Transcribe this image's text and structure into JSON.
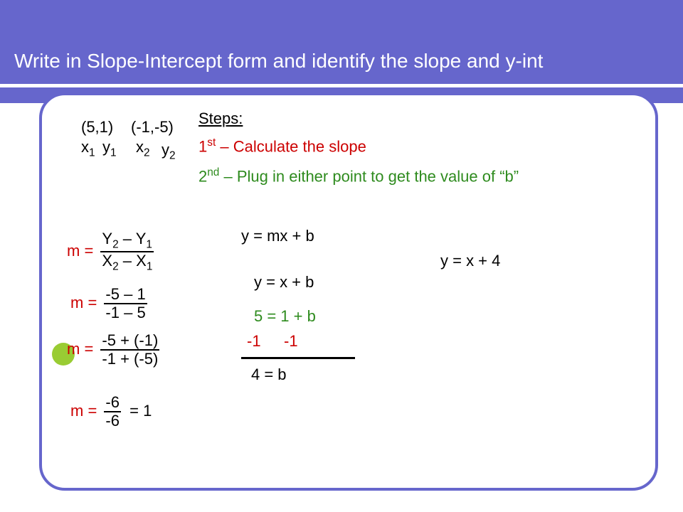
{
  "title": "Write in Slope-Intercept form and identify the slope and y-int",
  "points": {
    "p1": "(5,1)",
    "p2": "(-1,-5)",
    "label_x1": "x",
    "label_y1": "y",
    "label_x2": "x",
    "label_y2": "y",
    "sub1": "1",
    "sub2": "2"
  },
  "steps": {
    "header": "Steps:",
    "s1_prefix": "1",
    "s1_suffix": "st",
    "s1_text": " – Calculate the slope",
    "s2_prefix": "2",
    "s2_suffix": "nd",
    "s2_text": " – Plug in either point to get the value of “b”"
  },
  "slope": {
    "m_eq": "m =",
    "f1_top_a": "Y",
    "f1_top_b": " – Y",
    "f1_bot_a": "X",
    "f1_bot_b": " – X",
    "f2_top": "-5 – 1",
    "f2_bot": "-1 – 5",
    "f3_top": "-5 + (-1)",
    "f3_bot": "-1 + (-5)",
    "f4_top": "-6",
    "f4_bot": "-6",
    "eq1": "= 1"
  },
  "solve": {
    "l1": "y = mx + b",
    "l2": "y = x + b",
    "l3": "5 = 1 + b",
    "l4a": "-1",
    "l4b": "-1",
    "l5": "4 = b"
  },
  "answer": "y = x + 4"
}
